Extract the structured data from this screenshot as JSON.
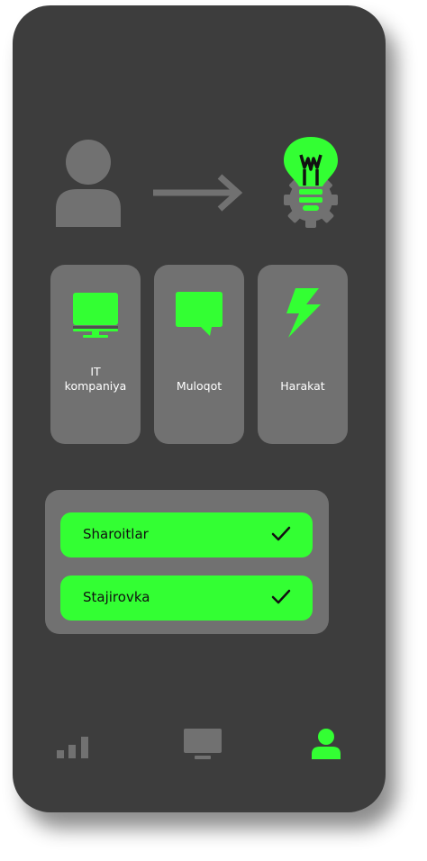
{
  "colors": {
    "phone_body": "#3d3d3d",
    "card_bg": "#717171",
    "accent_green": "#33ff33",
    "icon_gray": "#717171",
    "text_light": "#ffffff",
    "text_dark": "#111111"
  },
  "hero": {
    "left_icon": "user-icon",
    "middle_icon": "arrow-right-icon",
    "right_icon": "lightbulb-gear-icon"
  },
  "cards": [
    {
      "label": "IT\nkompaniya",
      "icon": "monitor-icon"
    },
    {
      "label": "Muloqot",
      "icon": "chat-bubble-icon"
    },
    {
      "label": "Harakat",
      "icon": "lightning-icon"
    }
  ],
  "checklist": [
    {
      "label": "Sharoitlar",
      "checked": true,
      "icon": "check-icon"
    },
    {
      "label": "Stajirovka",
      "checked": true,
      "icon": "check-icon"
    }
  ],
  "bottom_nav": [
    {
      "icon": "signal-bars-icon",
      "active": false
    },
    {
      "icon": "monitor-icon",
      "active": false
    },
    {
      "icon": "user-icon",
      "active": true
    }
  ]
}
